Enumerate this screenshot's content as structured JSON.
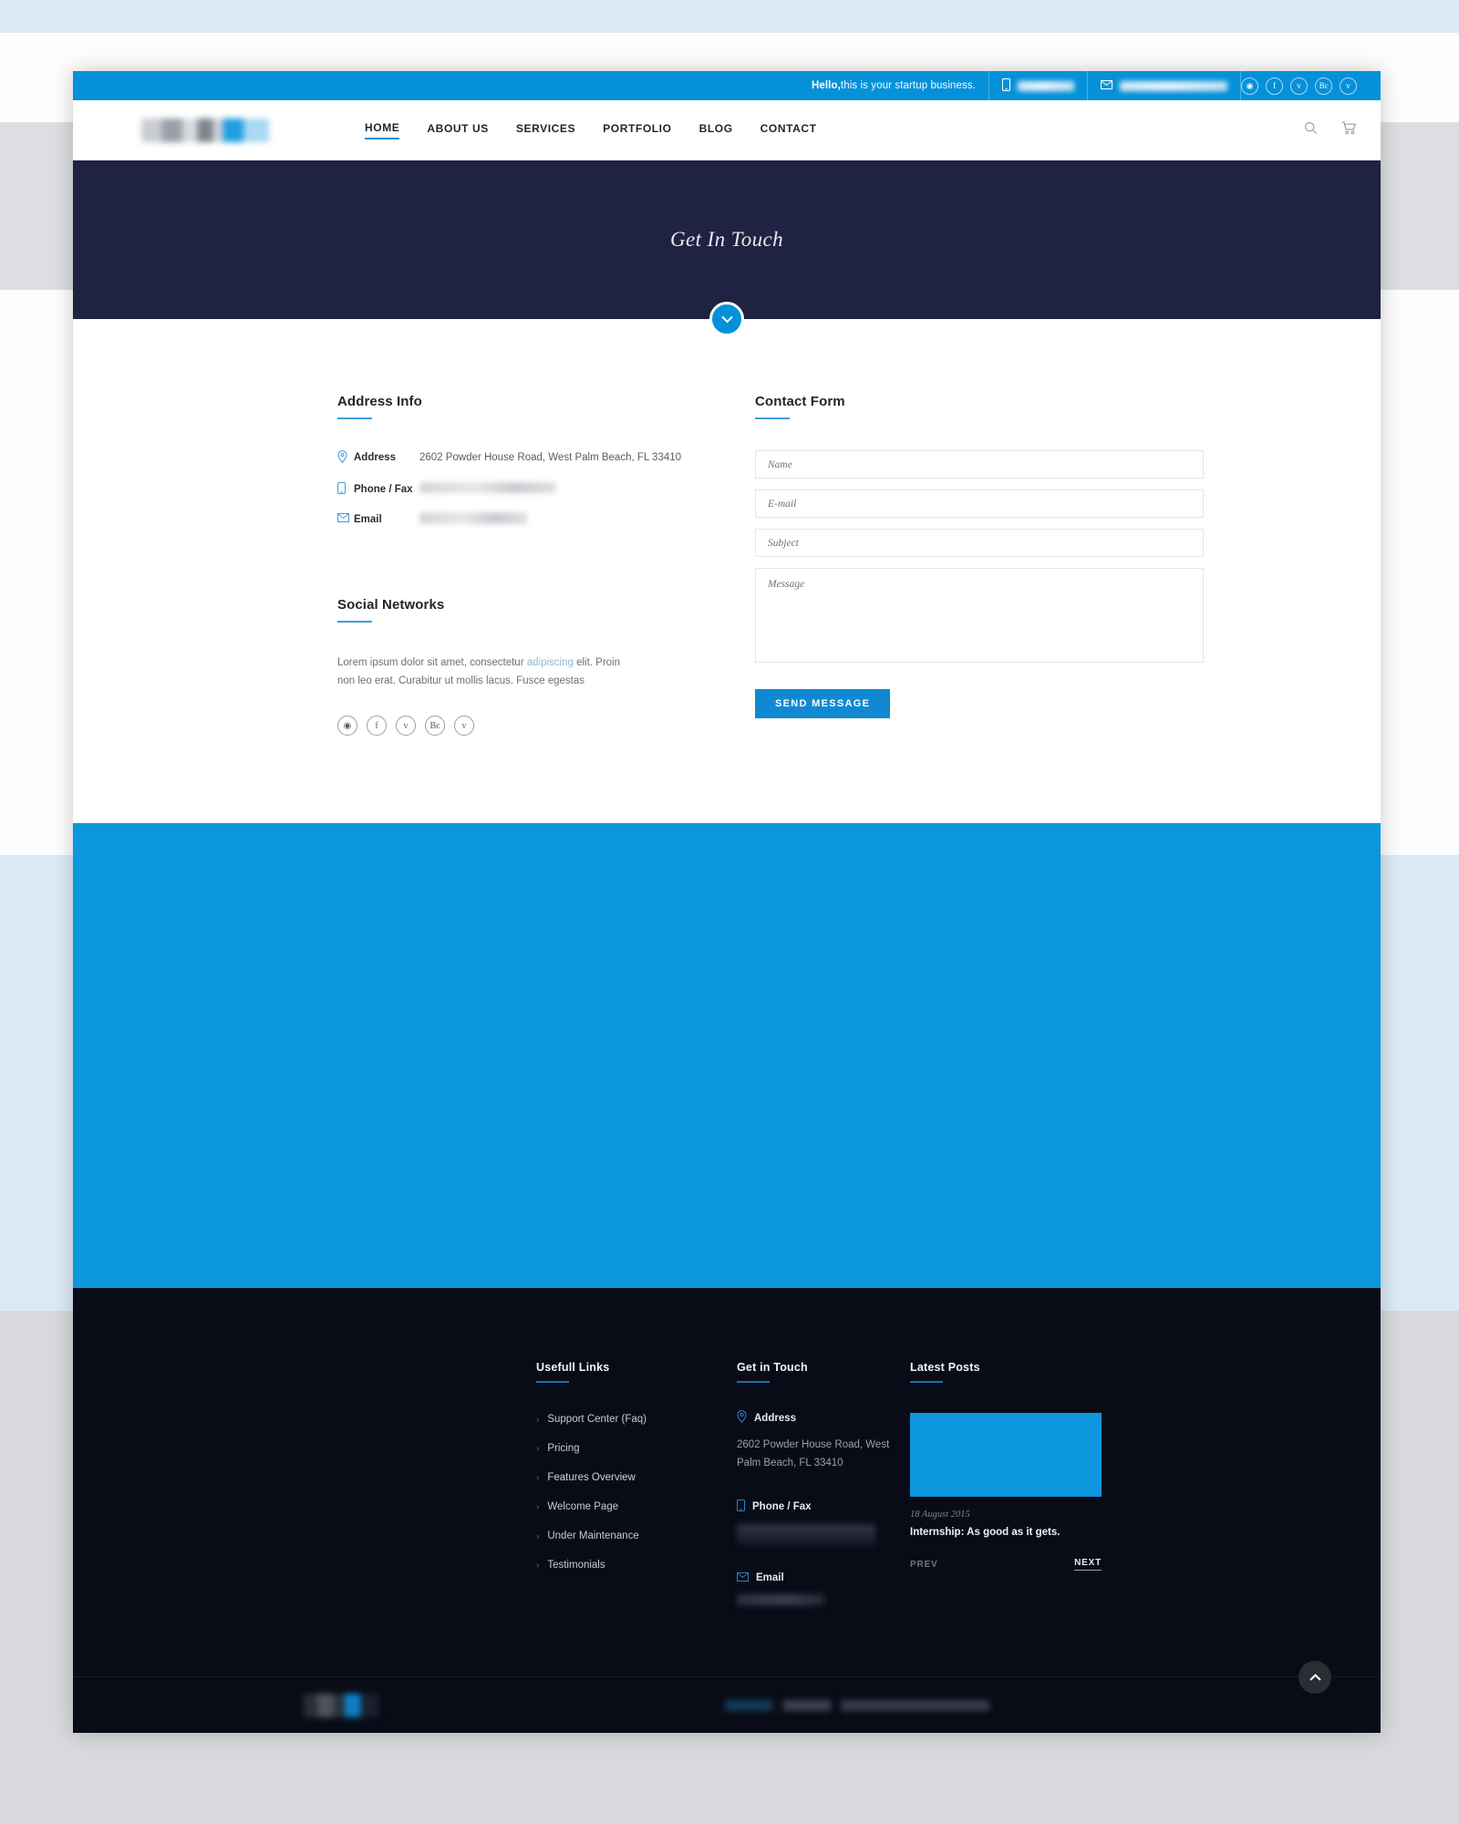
{
  "topbar": {
    "greeting_bold": "Hello,",
    "greeting_rest": " this is your startup business.",
    "phone_icon": "mobile-phone-icon",
    "email_icon": "envelope-icon",
    "socials": [
      {
        "name": "dribbble",
        "glyph": "◉"
      },
      {
        "name": "facebook",
        "glyph": "f"
      },
      {
        "name": "twitter",
        "glyph": "ᴠ"
      },
      {
        "name": "behance",
        "glyph": "Bє"
      },
      {
        "name": "vimeo",
        "glyph": "v"
      }
    ]
  },
  "nav": {
    "items": [
      {
        "label": "HOME",
        "active": true
      },
      {
        "label": "ABOUT US",
        "active": false
      },
      {
        "label": "SERVICES",
        "active": false
      },
      {
        "label": "PORTFOLIO",
        "active": false
      },
      {
        "label": "BLOG",
        "active": false
      },
      {
        "label": "CONTACT",
        "active": false
      }
    ],
    "search_icon": "search-icon",
    "cart_icon": "shopping-cart-icon"
  },
  "hero": {
    "title": "Get In Touch",
    "scroll_icon": "chevron-down-icon"
  },
  "address_info": {
    "heading": "Address Info",
    "rows": [
      {
        "icon": "map-pin-icon",
        "label": "Address",
        "value": "2602 Powder House Road, West Palm Beach, FL 33410",
        "blurred": false
      },
      {
        "icon": "mobile-phone-icon",
        "label": "Phone / Fax",
        "value": "",
        "blurred": true
      },
      {
        "icon": "envelope-icon",
        "label": "Email",
        "value": "",
        "blurred": true
      }
    ]
  },
  "social_networks": {
    "heading": "Social Networks",
    "paragraph_part1": "Lorem ipsum dolor sit amet, consectetur ",
    "paragraph_link": "adipiscing",
    "paragraph_part2": " elit. Proin non leo erat. Curabitur ut mollis lacus. Fusce egestas",
    "icons": [
      {
        "name": "dribbble",
        "glyph": "◉"
      },
      {
        "name": "facebook",
        "glyph": "f"
      },
      {
        "name": "twitter",
        "glyph": "ᴠ"
      },
      {
        "name": "behance",
        "glyph": "Bє"
      },
      {
        "name": "vimeo",
        "glyph": "v"
      }
    ]
  },
  "contact_form": {
    "heading": "Contact Form",
    "name_placeholder": "Name",
    "email_placeholder": "E-mail",
    "subject_placeholder": "Subject",
    "message_placeholder": "Message",
    "submit_label": "SEND MESSAGE",
    "name_value": "",
    "email_value": "",
    "subject_value": "",
    "message_value": ""
  },
  "footer": {
    "links_col": {
      "heading": "Usefull Links",
      "items": [
        {
          "label": "Support Center (Faq)",
          "highlight": false
        },
        {
          "label": "Pricing",
          "highlight": false
        },
        {
          "label": "Features Overview",
          "highlight": true
        },
        {
          "label": "Welcome Page",
          "highlight": false
        },
        {
          "label": "Under Maintenance",
          "highlight": false
        },
        {
          "label": "Testimonials",
          "highlight": false
        }
      ]
    },
    "touch_col": {
      "heading": "Get in Touch",
      "address_label": "Address",
      "address_value": "2602 Powder House Road, West Palm Beach, FL 33410",
      "phone_label": "Phone / Fax",
      "email_label": "Email"
    },
    "posts_col": {
      "heading": "Latest Posts",
      "date": "18 August 2015",
      "title": "Internship: As good as it gets.",
      "prev_label": "PREV",
      "next_label": "NEXT"
    },
    "to_top_icon": "chevron-up-icon"
  },
  "colors": {
    "accent_blue": "#0591d9",
    "hero_navy": "#1f2240",
    "footer_dark": "#090c16",
    "band_blue": "#0b96dd"
  }
}
